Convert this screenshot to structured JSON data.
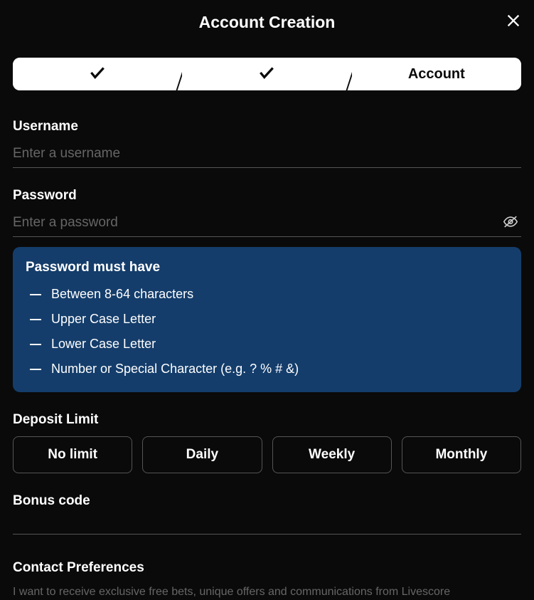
{
  "header": {
    "title": "Account Creation"
  },
  "stepper": {
    "step3_label": "Account"
  },
  "username": {
    "label": "Username",
    "placeholder": "Enter a username",
    "value": ""
  },
  "password": {
    "label": "Password",
    "placeholder": "Enter a password",
    "value": "",
    "requirements": {
      "title": "Password must have",
      "items": [
        "Between 8-64 characters",
        "Upper Case Letter",
        "Lower Case Letter",
        "Number or Special Character (e.g. ? % # &)"
      ]
    }
  },
  "deposit": {
    "label": "Deposit Limit",
    "options": [
      "No limit",
      "Daily",
      "Weekly",
      "Monthly"
    ]
  },
  "bonus": {
    "label": "Bonus code",
    "value": ""
  },
  "contact": {
    "label": "Contact Preferences",
    "text": "I want to receive exclusive free bets, unique offers and communications from Livescore"
  }
}
